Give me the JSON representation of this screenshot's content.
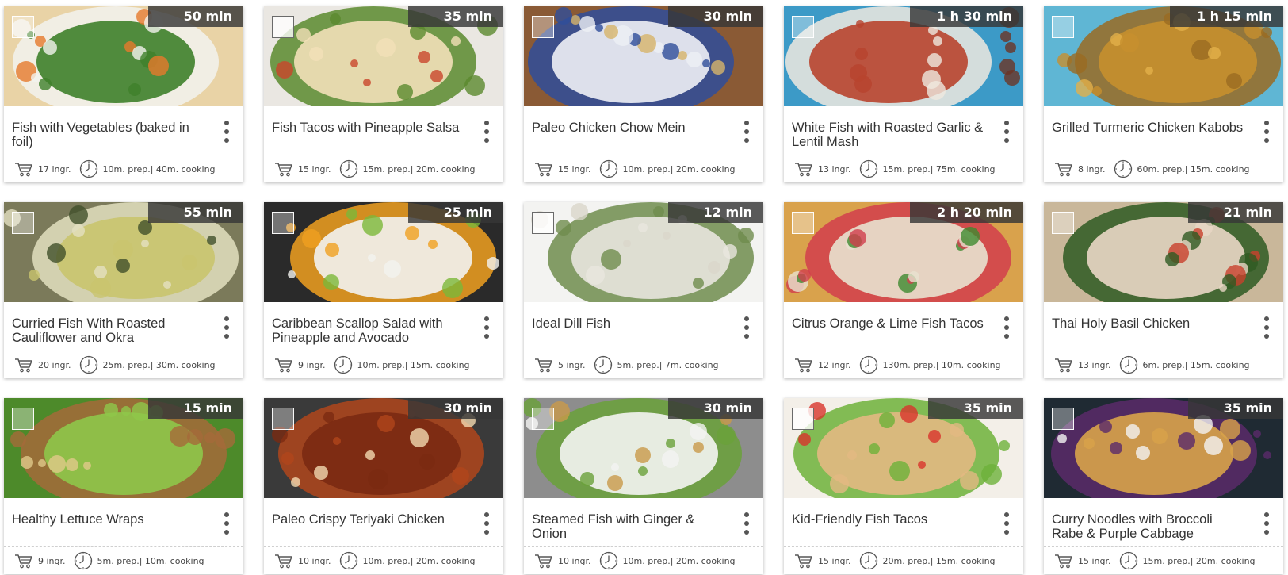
{
  "recipes": [
    {
      "title": "Fish with Vegetables (baked in foil)",
      "time": "50 min",
      "ingredients": "17 ingr.",
      "prep": "10m. prep.| 40m. cooking",
      "image": {
        "bg": "#e9d3a6",
        "accent": [
          "#3e7f2a",
          "#f2f2ee",
          "#e6792c"
        ]
      }
    },
    {
      "title": "Fish Tacos with Pineapple Salsa",
      "time": "35 min",
      "ingredients": "15 ingr.",
      "prep": "15m. prep.| 20m. cooking",
      "image": {
        "bg": "#eae7e2",
        "accent": [
          "#f2e0b8",
          "#5b8a2e",
          "#c9462c"
        ]
      }
    },
    {
      "title": "Paleo Chicken Chow Mein",
      "time": "30 min",
      "ingredients": "15 ingr.",
      "prep": "10m. prep.| 20m. cooking",
      "image": {
        "bg": "#8a5a35",
        "accent": [
          "#eef0f5",
          "#2f4d9a",
          "#d7b46a"
        ]
      }
    },
    {
      "title": "White Fish with Roasted Garlic & Lentil Mash",
      "time": "1 h 30 min",
      "ingredients": "13 ingr.",
      "prep": "15m. prep.| 75m. cooking",
      "image": {
        "bg": "#3c9ac7",
        "accent": [
          "#b8442e",
          "#efe9df",
          "#6b3426"
        ]
      }
    },
    {
      "title": "Grilled Turmeric Chicken Kabobs",
      "time": "1 h 15 min",
      "ingredients": "8 ingr.",
      "prep": "60m. prep.| 15m. cooking",
      "image": {
        "bg": "#5fb6d4",
        "accent": [
          "#c7902e",
          "#9a6b22",
          "#e2b04a"
        ]
      }
    },
    {
      "title": "Curried Fish With Roasted Cauliflower and Okra",
      "time": "55 min",
      "ingredients": "20 ingr.",
      "prep": "25m. prep.| 30m. cooking",
      "image": {
        "bg": "#7b7a5a",
        "accent": [
          "#c9c46e",
          "#e3e0c0",
          "#41502a"
        ]
      }
    },
    {
      "title": "Caribbean Scallop Salad with Pineapple and Avocado",
      "time": "25 min",
      "ingredients": "9 ingr.",
      "prep": "10m. prep.| 15m. cooking",
      "image": {
        "bg": "#2a2a2a",
        "accent": [
          "#f2f2ef",
          "#f0a020",
          "#7cb83a"
        ]
      }
    },
    {
      "title": "Ideal Dill Fish",
      "time": "12 min",
      "ingredients": "5 ingr.",
      "prep": "5m. prep.| 7m. cooking",
      "image": {
        "bg": "#f3f3f1",
        "accent": [
          "#e8e6de",
          "#6f8c4e",
          "#d9d6cb"
        ]
      }
    },
    {
      "title": "Citrus Orange & Lime Fish Tacos",
      "time": "2 h 20 min",
      "ingredients": "12 ingr.",
      "prep": "130m. prep.| 10m. cooking",
      "image": {
        "bg": "#d9a24c",
        "accent": [
          "#e8e2cf",
          "#d13e4c",
          "#3e8a2f"
        ]
      }
    },
    {
      "title": "Thai Holy Basil Chicken",
      "time": "21 min",
      "ingredients": "13 ingr.",
      "prep": "6m. prep.| 15m. cooking",
      "image": {
        "bg": "#c9b79a",
        "accent": [
          "#e9d7c5",
          "#2e5a22",
          "#c8402c"
        ]
      }
    },
    {
      "title": "Healthy Lettuce Wraps",
      "time": "15 min",
      "ingredients": "9 ingr.",
      "prep": "5m. prep.| 10m. cooking",
      "image": {
        "bg": "#4d8a2a",
        "accent": [
          "#8ec74a",
          "#a56a3a",
          "#e0c98a"
        ]
      }
    },
    {
      "title": "Paleo Crispy Teriyaki Chicken",
      "time": "30 min",
      "ingredients": "10 ingr.",
      "prep": "10m. prep.| 20m. cooking",
      "image": {
        "bg": "#3a3a3a",
        "accent": [
          "#7a2a12",
          "#b0461c",
          "#f3d9b0"
        ]
      }
    },
    {
      "title": "Steamed Fish with Ginger & Onion",
      "time": "30 min",
      "ingredients": "10 ingr.",
      "prep": "10m. prep.| 20m. cooking",
      "image": {
        "bg": "#8d8d8d",
        "accent": [
          "#f4f4f2",
          "#6aa13a",
          "#c99a4a"
        ]
      }
    },
    {
      "title": "Kid-Friendly Fish Tacos",
      "time": "35 min",
      "ingredients": "15 ingr.",
      "prep": "20m. prep.| 15m. cooking",
      "image": {
        "bg": "#f3efe8",
        "accent": [
          "#e2b982",
          "#6db23a",
          "#d8342c"
        ]
      }
    },
    {
      "title": "Curry Noodles with Broccoli Rabe & Purple Cabbage",
      "time": "35 min",
      "ingredients": "15 ingr.",
      "prep": "15m. prep.| 20m. cooking",
      "image": {
        "bg": "#1f2a33",
        "accent": [
          "#d8a34a",
          "#5a2a6a",
          "#f2f2f2"
        ]
      }
    }
  ],
  "icons": {
    "cart": "cart-icon",
    "clock": "clock-icon",
    "more": "more-vertical-icon",
    "select": "checkbox-icon"
  }
}
